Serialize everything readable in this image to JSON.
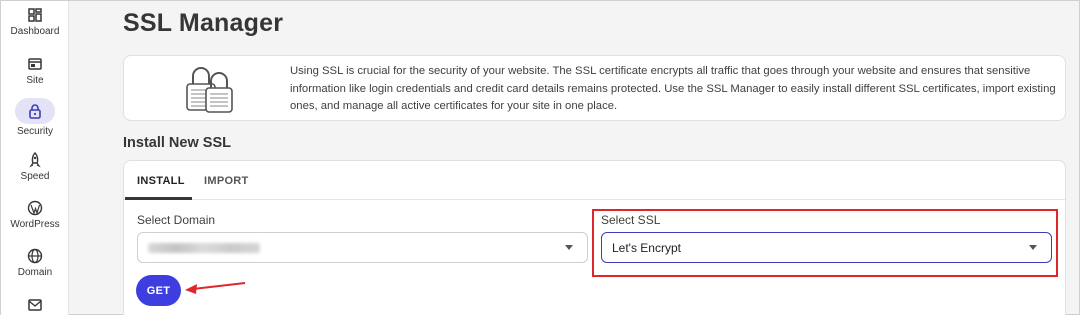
{
  "sidebar": {
    "items": [
      {
        "label": "Dashboard",
        "icon": "dashboard-icon"
      },
      {
        "label": "Site",
        "icon": "site-icon"
      },
      {
        "label": "Security",
        "icon": "lock-icon",
        "active": true
      },
      {
        "label": "Speed",
        "icon": "rocket-icon"
      },
      {
        "label": "WordPress",
        "icon": "wordpress-icon"
      },
      {
        "label": "Domain",
        "icon": "globe-icon"
      },
      {
        "label": "",
        "icon": "mail-icon"
      }
    ]
  },
  "page": {
    "title": "SSL Manager",
    "info_text": "Using SSL is crucial for the security of your website. The SSL certificate encrypts all traffic that goes through your website and ensures that sensitive information like login credentials and credit card details remains protected. Use the SSL Manager to easily install different SSL certificates, import existing ones, and manage all active certificates for your site in one place."
  },
  "install": {
    "section_title": "Install New SSL",
    "tabs": [
      {
        "label": "INSTALL",
        "active": true
      },
      {
        "label": "IMPORT",
        "active": false
      }
    ],
    "domain_label": "Select Domain",
    "ssl_label": "Select SSL",
    "ssl_value": "Let's Encrypt",
    "get_label": "GET"
  },
  "colors": {
    "accent": "#3d3de0",
    "active_nav_bg": "#e4e2f7",
    "annotation_red": "#e0262b"
  }
}
